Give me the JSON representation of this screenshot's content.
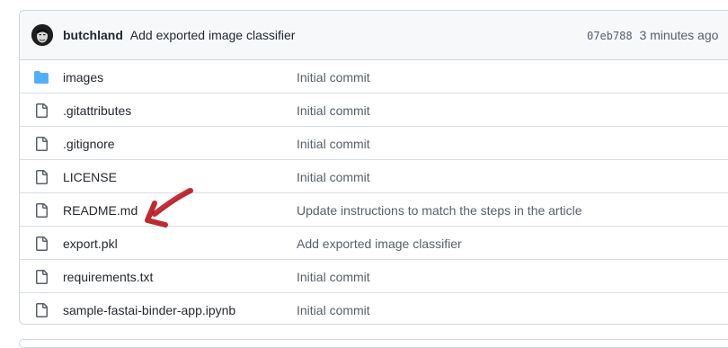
{
  "commit": {
    "author": "butchland",
    "message": "Add exported image classifier",
    "sha": "07eb788",
    "time": "3 minutes ago"
  },
  "files": [
    {
      "name": "images",
      "message": "Initial commit",
      "icon": "folder-icon"
    },
    {
      "name": ".gitattributes",
      "message": "Initial commit",
      "icon": "file-icon"
    },
    {
      "name": ".gitignore",
      "message": "Initial commit",
      "icon": "file-icon"
    },
    {
      "name": "LICENSE",
      "message": "Initial commit",
      "icon": "file-icon"
    },
    {
      "name": "README.md",
      "message": "Update instructions to match the steps in the article",
      "icon": "file-icon"
    },
    {
      "name": "export.pkl",
      "message": "Add exported image classifier",
      "icon": "file-icon"
    },
    {
      "name": "requirements.txt",
      "message": "Initial commit",
      "icon": "file-icon"
    },
    {
      "name": "sample-fastai-binder-app.ipynb",
      "message": "Initial commit",
      "icon": "file-icon"
    }
  ],
  "colors": {
    "folder": "#54aeff",
    "file_icon": "#57606a",
    "annotation_arrow": "#b5141c"
  }
}
